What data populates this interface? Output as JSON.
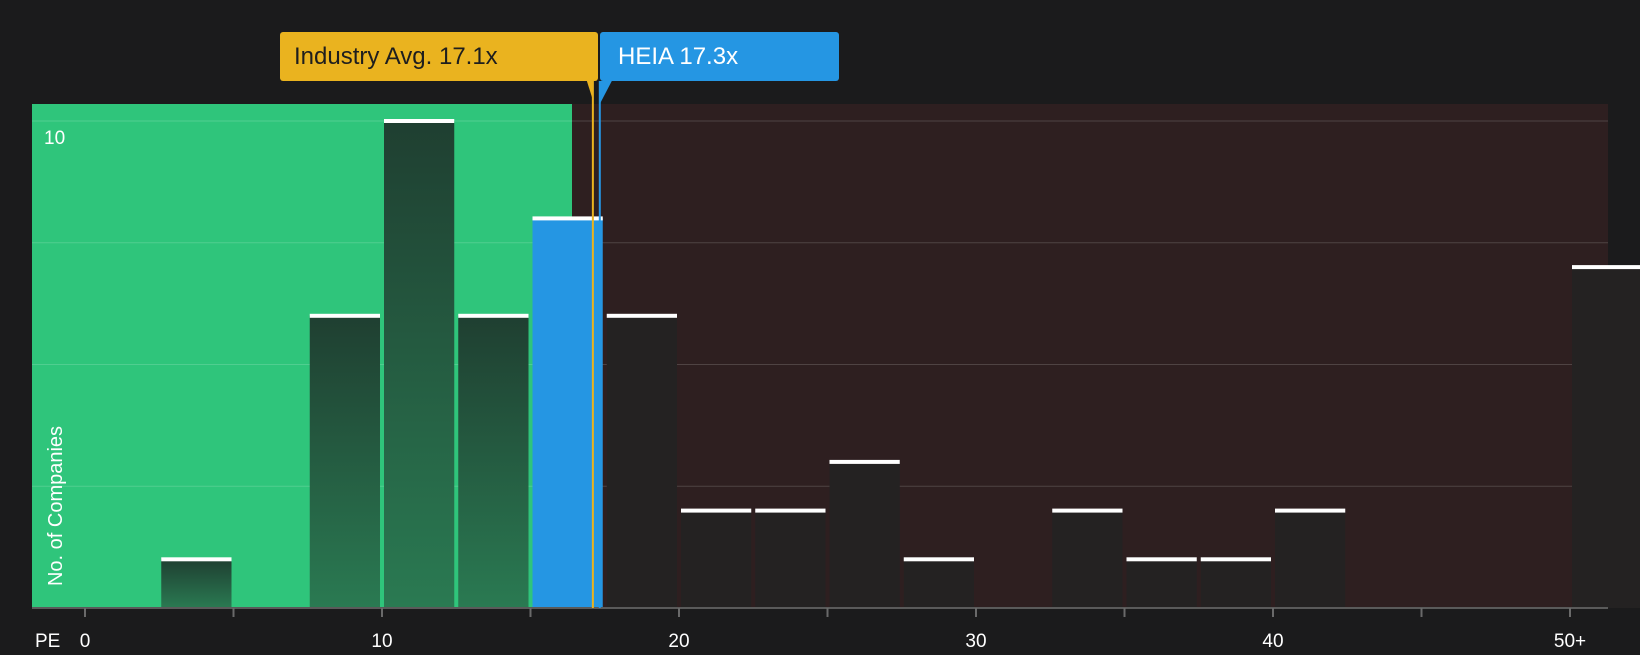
{
  "chart_data": {
    "type": "bar",
    "metric_label": "PE",
    "ylabel": "No. of Companies",
    "ylim": [
      0,
      10
    ],
    "y_tick_label": "10",
    "x_ticks": [
      {
        "value": 0,
        "label": "0"
      },
      {
        "value": 10,
        "label": "10"
      },
      {
        "value": 20,
        "label": "20"
      },
      {
        "value": 30,
        "label": "30"
      },
      {
        "value": 40,
        "label": "40"
      },
      {
        "value": 50,
        "label": "50+"
      }
    ],
    "bins": [
      {
        "from": 2.5,
        "to": 5.0,
        "count": 1
      },
      {
        "from": 7.5,
        "to": 10.0,
        "count": 6
      },
      {
        "from": 10.0,
        "to": 12.5,
        "count": 10
      },
      {
        "from": 12.5,
        "to": 15.0,
        "count": 6
      },
      {
        "from": 15.0,
        "to": 17.5,
        "count": 8,
        "highlight": true
      },
      {
        "from": 17.5,
        "to": 20.0,
        "count": 6
      },
      {
        "from": 20.0,
        "to": 22.5,
        "count": 2
      },
      {
        "from": 22.5,
        "to": 25.0,
        "count": 2
      },
      {
        "from": 25.0,
        "to": 27.5,
        "count": 3
      },
      {
        "from": 27.5,
        "to": 30.0,
        "count": 1
      },
      {
        "from": 32.5,
        "to": 35.0,
        "count": 2
      },
      {
        "from": 35.0,
        "to": 37.5,
        "count": 1
      },
      {
        "from": 37.5,
        "to": 40.0,
        "count": 1
      },
      {
        "from": 40.0,
        "to": 42.5,
        "count": 2
      },
      {
        "from": 50.0,
        "to": 52.5,
        "count": 7
      }
    ],
    "industry_avg": {
      "value": 17.1,
      "label": "Industry Avg. 17.1x"
    },
    "company": {
      "ticker": "HEIA",
      "value": 17.3,
      "label": "HEIA 17.3x"
    },
    "colors": {
      "background": "#1b1b1c",
      "undervalued_zone": "#2fc57b",
      "overvalued_zone": "#2e1f20",
      "bar_dark_top": "#1f3f31",
      "bar_dark_bottom": "#2a7a52",
      "bar_right": "#242222",
      "highlight_bar": "#2596e3",
      "industry_line": "#eab31f",
      "company_line": "#2596e3",
      "cap": "#ffffff"
    }
  }
}
